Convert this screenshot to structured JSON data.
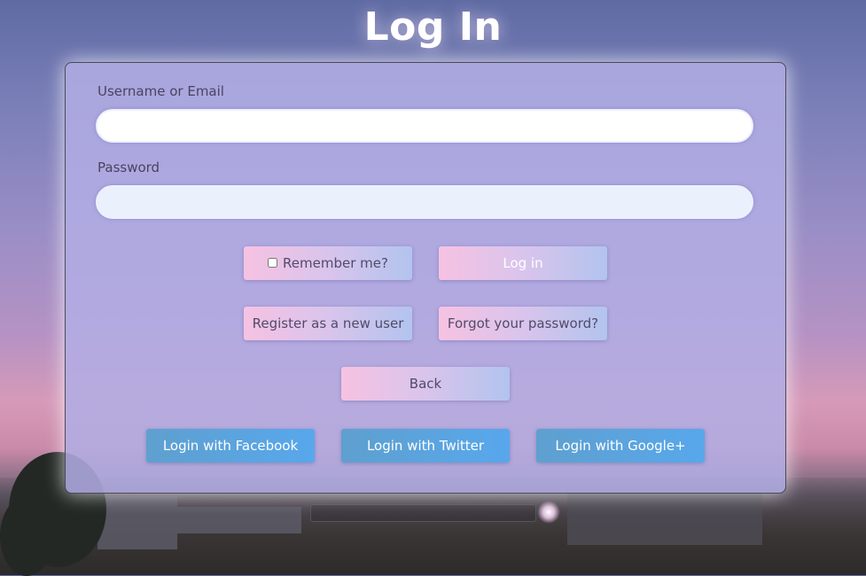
{
  "page": {
    "title": "Log In"
  },
  "form": {
    "username": {
      "label": "Username or Email",
      "value": "",
      "placeholder": ""
    },
    "password": {
      "label": "Password",
      "value": "",
      "placeholder": ""
    },
    "remember_label": "Remember me?",
    "remember_checked": false,
    "login_label": "Log in",
    "register_label": "Register as a new user",
    "forgot_label": "Forgot your password?",
    "back_label": "Back"
  },
  "social": {
    "facebook_label": "Login with Facebook",
    "twitter_label": "Login with Twitter",
    "google_label": "Login with Google+"
  },
  "colors": {
    "panel": "#b2aee4",
    "gradient_button_start": "#f6c2e2",
    "gradient_button_end": "#b2c4ee",
    "social_button": "#58a7ec",
    "title": "#ffffff"
  }
}
